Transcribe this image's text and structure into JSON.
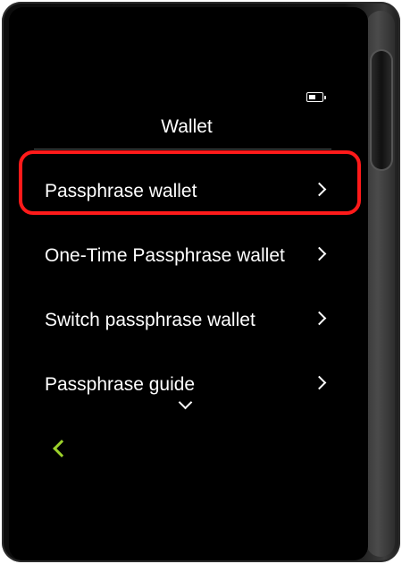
{
  "header": {
    "title": "Wallet",
    "battery_icon": "battery-icon"
  },
  "menu": {
    "items": [
      {
        "label": "Passphrase wallet",
        "icon": "chevron-right-icon",
        "highlighted": true
      },
      {
        "label": "One-Time Passphrase wallet",
        "icon": "chevron-right-icon"
      },
      {
        "label": "Switch passphrase wallet",
        "icon": "chevron-right-icon"
      },
      {
        "label": "Passphrase guide",
        "icon": "chevron-right-icon"
      }
    ]
  },
  "footer": {
    "scroll_icon": "chevron-down-icon",
    "back_icon": "chevron-left-icon"
  },
  "colors": {
    "highlight": "#ff1a1a",
    "accent": "#9cd12b",
    "screen": "#000000",
    "text": "#ffffff"
  }
}
